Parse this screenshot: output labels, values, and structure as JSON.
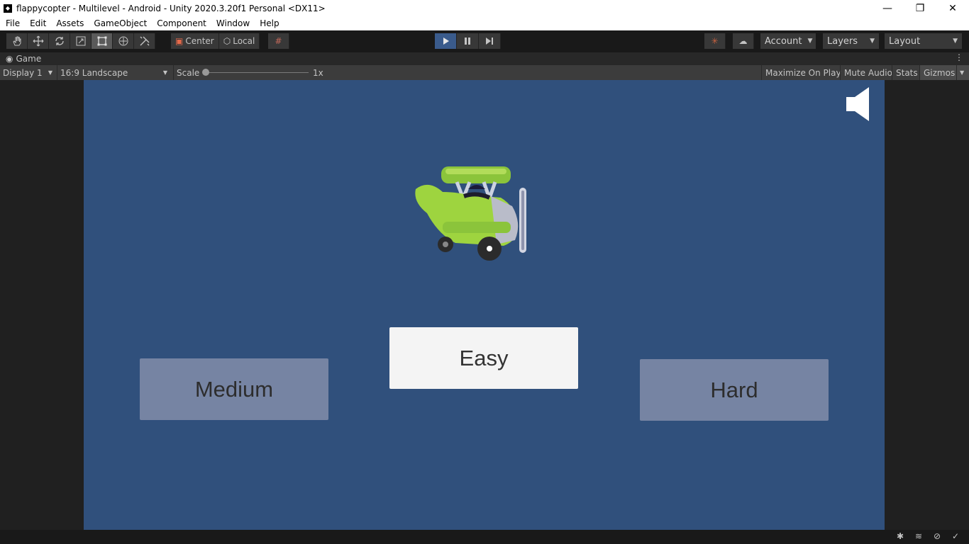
{
  "window": {
    "title": "flappycopter - Multilevel - Android - Unity 2020.3.20f1 Personal <DX11>",
    "controls": {
      "minimize": "—",
      "maximize": "❐",
      "close": "✕"
    }
  },
  "menu": [
    "File",
    "Edit",
    "Assets",
    "GameObject",
    "Component",
    "Window",
    "Help"
  ],
  "toolbar": {
    "tools": [
      {
        "name": "hand-tool",
        "icon": "hand-icon"
      },
      {
        "name": "move-tool",
        "icon": "move-icon"
      },
      {
        "name": "rotate-tool",
        "icon": "rotate-icon"
      },
      {
        "name": "scale-tool",
        "icon": "scale-icon"
      },
      {
        "name": "rect-tool",
        "icon": "rect-icon",
        "active": true
      },
      {
        "name": "transform-tool",
        "icon": "transform-icon"
      },
      {
        "name": "custom-tool",
        "icon": "tools-icon"
      }
    ],
    "pivot_label": "Center",
    "space_label": "Local",
    "account_label": "Account",
    "layers_label": "Layers",
    "layout_label": "Layout"
  },
  "tab": {
    "label": "Game"
  },
  "gamebar": {
    "display": "Display 1",
    "aspect": "16:9 Landscape",
    "scale_label": "Scale",
    "scale_value": "1x",
    "maximize_on_play": "Maximize On Play",
    "mute_audio": "Mute Audio",
    "stats": "Stats",
    "gizmos": "Gizmos"
  },
  "game": {
    "background": "#30507c",
    "buttons": {
      "medium": "Medium",
      "easy": "Easy",
      "hard": "Hard"
    }
  }
}
